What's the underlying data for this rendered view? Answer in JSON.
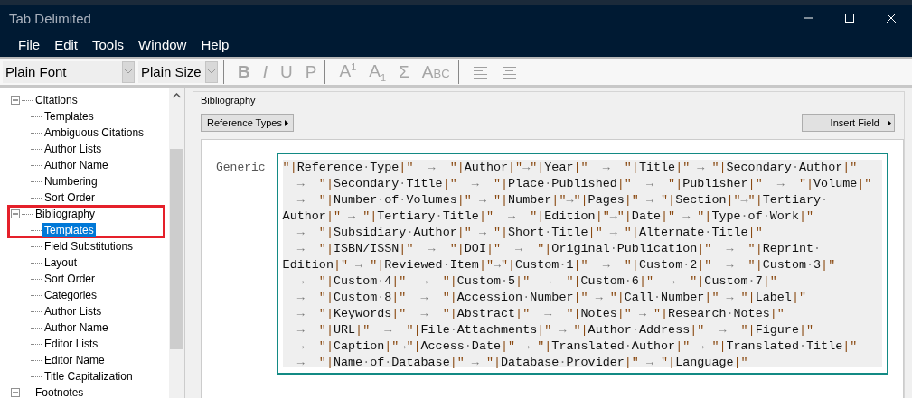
{
  "window": {
    "title": "Tab Delimited"
  },
  "menu": [
    "File",
    "Edit",
    "Tools",
    "Window",
    "Help"
  ],
  "toolbar": {
    "font": "Plain Font",
    "size": "Plain Size",
    "format_buttons": [
      {
        "label": "B",
        "kind": "bold",
        "disabled": true
      },
      {
        "label": "I",
        "kind": "italic",
        "disabled": true
      },
      {
        "label": "U",
        "kind": "underline",
        "disabled": true
      },
      {
        "label": "P",
        "kind": "plain",
        "disabled": true
      },
      {
        "label": "A$^{1}$",
        "kind": "script",
        "disabled": true
      },
      {
        "label": "A$_{1}$",
        "kind": "script",
        "disabled": true
      },
      {
        "label": "Σ",
        "kind": "symbol",
        "disabled": true
      },
      {
        "label": "Abc",
        "kind": "smallcaps",
        "disabled": true
      }
    ]
  },
  "tree": [
    {
      "label": "Citations",
      "expanded": true,
      "selected": false,
      "highlighted": false,
      "children": [
        {
          "label": "Templates",
          "selected": false,
          "highlighted": false
        },
        {
          "label": "Ambiguous Citations",
          "selected": false,
          "highlighted": false
        },
        {
          "label": "Author Lists",
          "selected": false,
          "highlighted": false
        },
        {
          "label": "Author Name",
          "selected": false,
          "highlighted": false
        },
        {
          "label": "Numbering",
          "selected": false,
          "highlighted": false
        },
        {
          "label": "Sort Order",
          "selected": false,
          "highlighted": false
        }
      ]
    },
    {
      "label": "Bibliography",
      "expanded": true,
      "selected": false,
      "highlighted": true,
      "children": [
        {
          "label": "Templates",
          "selected": true,
          "highlighted": false
        },
        {
          "label": "Field Substitutions",
          "selected": false,
          "highlighted": false
        },
        {
          "label": "Layout",
          "selected": false,
          "highlighted": false
        },
        {
          "label": "Sort Order",
          "selected": false,
          "highlighted": false
        },
        {
          "label": "Categories",
          "selected": false,
          "highlighted": false
        },
        {
          "label": "Author Lists",
          "selected": false,
          "highlighted": false
        },
        {
          "label": "Author Name",
          "selected": false,
          "highlighted": false
        },
        {
          "label": "Editor Lists",
          "selected": false,
          "highlighted": false
        },
        {
          "label": "Editor Name",
          "selected": false,
          "highlighted": false
        },
        {
          "label": "Title Capitalization",
          "selected": false,
          "highlighted": false
        }
      ]
    },
    {
      "label": "Footnotes",
      "expanded": true,
      "selected": false,
      "highlighted": false
    }
  ],
  "panel": {
    "group": "Bibliography",
    "reference_types_button": "Reference Types",
    "insert_field_button": "Insert Field",
    "template": {
      "label": "Generic",
      "lines": [
        "\"|Reference·Type|\"  →  \"|Author|\"→\"|Year|\"  →  \"|Title|\" → \"|Secondary·Author|\"",
        "  →  \"|Secondary·Title|\"  →  \"|Place·Published|\"  →  \"|Publisher|\"  →  \"|Volume|\"",
        "  →  \"|Number·of·Volumes|\" → \"|Number|\"→\"|Pages|\" → \"|Section|\"→\"|Tertiary·",
        "Author|\" → \"|Tertiary·Title|\"  →  \"|Edition|\"→\"|Date|\" → \"|Type·of·Work|\"",
        "  →  \"|Subsidiary·Author|\" → \"|Short·Title|\" → \"|Alternate·Title|\"",
        "  →  \"|ISBN/ISSN|\"  →  \"|DOI|\"  →  \"|Original·Publication|\"  →  \"|Reprint·",
        "Edition|\" → \"|Reviewed·Item|\"→\"|Custom·1|\"  →  \"|Custom·2|\"  →  \"|Custom·3|\"",
        "  →  \"|Custom·4|\"  →  \"|Custom·5|\"  →  \"|Custom·6|\"  →  \"|Custom·7|\"",
        "  →  \"|Custom·8|\"  →  \"|Accession·Number|\" → \"|Call·Number|\" → \"|Label|\"",
        "  →  \"|Keywords|\"  →  \"|Abstract|\"  →  \"|Notes|\" → \"|Research·Notes|\"",
        "  →  \"|URL|\"  →  \"|File·Attachments|\" → \"|Author·Address|\"  →  \"|Figure|\"",
        "  →  \"|Caption|\"→\"|Access·Date|\" → \"|Translated·Author|\" → \"|Translated·Title|\"",
        "  →  \"|Name·of·Database|\" → \"|Database·Provider|\" → \"|Language|\""
      ]
    }
  }
}
